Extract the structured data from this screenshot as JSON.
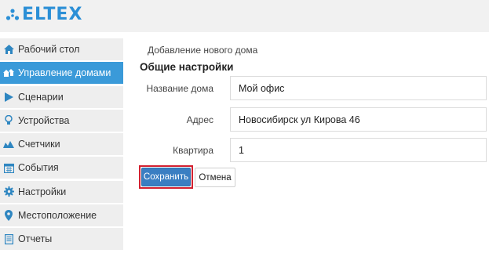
{
  "app": {
    "brand": "ELTEX",
    "brand_color": "#2b8fd6",
    "accent": "#3a9ad9"
  },
  "sidebar": {
    "items": [
      {
        "label": "Рабочий стол",
        "icon": "home-icon",
        "active": false
      },
      {
        "label": "Управление домами",
        "icon": "houses-icon",
        "active": true
      },
      {
        "label": "Сценарии",
        "icon": "play-icon",
        "active": false
      },
      {
        "label": "Устройства",
        "icon": "lightbulb-icon",
        "active": false
      },
      {
        "label": "Счетчики",
        "icon": "meters-icon",
        "active": false
      },
      {
        "label": "События",
        "icon": "calendar-icon",
        "active": false
      },
      {
        "label": "Настройки",
        "icon": "gear-icon",
        "active": false
      },
      {
        "label": "Местоположение",
        "icon": "map-pin-icon",
        "active": false
      },
      {
        "label": "Отчеты",
        "icon": "report-icon",
        "active": false
      }
    ]
  },
  "main": {
    "breadcrumb": "Добавление нового дома",
    "section_title": "Общие настройки",
    "fields": {
      "house_name": {
        "label": "Название дома",
        "value": "Мой офис"
      },
      "address": {
        "label": "Адрес",
        "value": "Новосибирск ул Кирова 46"
      },
      "apartment": {
        "label": "Квартира",
        "value": "1"
      }
    },
    "buttons": {
      "save": "Сохранить",
      "cancel": "Отмена"
    }
  }
}
